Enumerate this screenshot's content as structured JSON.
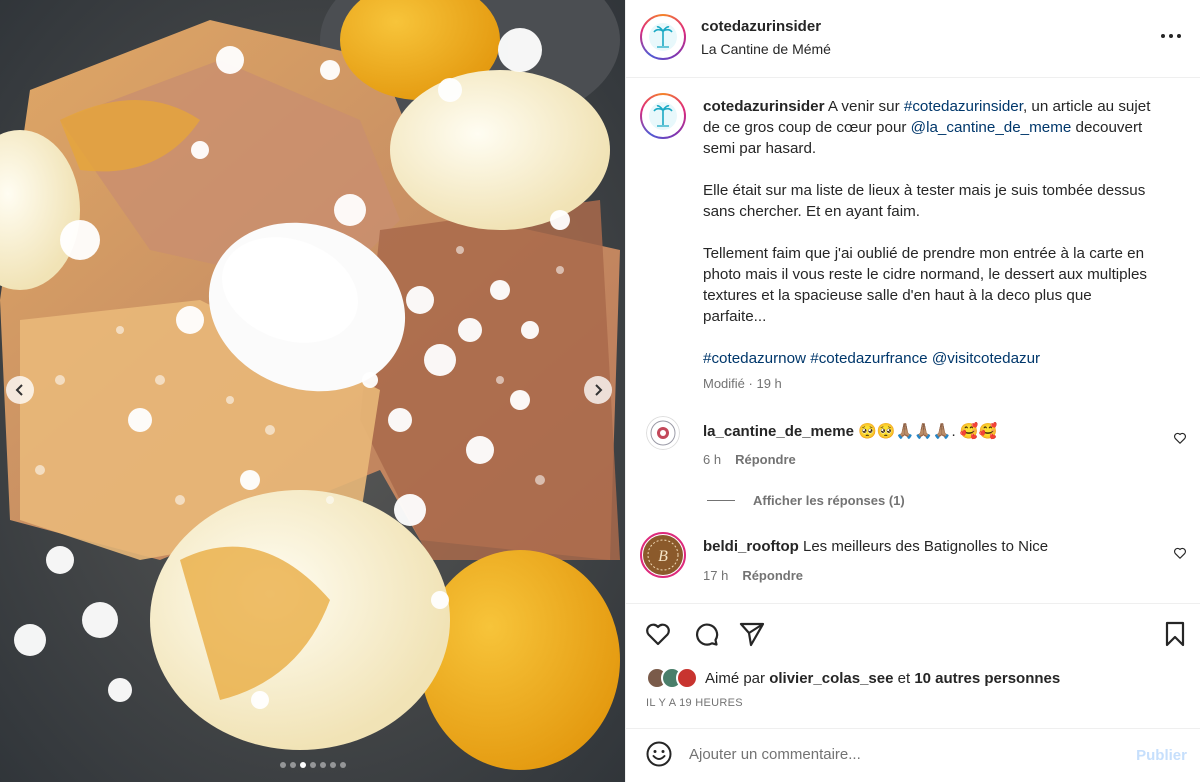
{
  "header": {
    "username": "cotedazurinsider",
    "location": "La Cantine de Mémé"
  },
  "caption": {
    "username": "cotedazurinsider",
    "line1_pre": " A venir sur ",
    "tag1": "#cotedazurinsider",
    "line1_mid": ", un article au sujet de ce gros coup de cœur pour ",
    "tag2": "@la_cantine_de_meme",
    "line1_post": " decouvert semi par hasard.",
    "para2": "Elle était sur ma liste de lieux à tester mais je suis tombée dessus sans chercher. Et en ayant faim.",
    "para3": "Tellement faim que j'ai oublié de prendre mon entrée à la carte en photo mais il vous reste le cidre normand, le dessert aux multiples textures et la spacieuse salle d'en haut à la deco plus que parfaite...",
    "tags": [
      "#cotedazurnow",
      "#cotedazurfrance",
      "@visitcotedazur"
    ],
    "edited": "Modifié",
    "time": "19 h"
  },
  "comments": [
    {
      "username": "la_cantine_de_meme",
      "text": " 🥺🥺🙏🏽🙏🏽🙏🏽. 🥰🥰",
      "time": "6 h",
      "reply": "Répondre"
    },
    {
      "username": "beldi_rooftop",
      "text": " Les meilleurs des Batignolles to Nice",
      "time": "17 h",
      "reply": "Répondre"
    }
  ],
  "view_replies": "Afficher les réponses (1)",
  "likes": {
    "prefix": "Aimé par ",
    "user": "olivier_colas_see",
    "mid": " et ",
    "others": "10 autres personnes"
  },
  "post_time": "IL Y A 19 HEURES",
  "add_comment": {
    "placeholder": "Ajouter un commentaire...",
    "publish": "Publier"
  },
  "carousel": {
    "total": 7,
    "active_index": 2
  },
  "colors": {
    "link": "#00376b",
    "muted": "#737373",
    "publish_disabled": "#c6dffc"
  }
}
